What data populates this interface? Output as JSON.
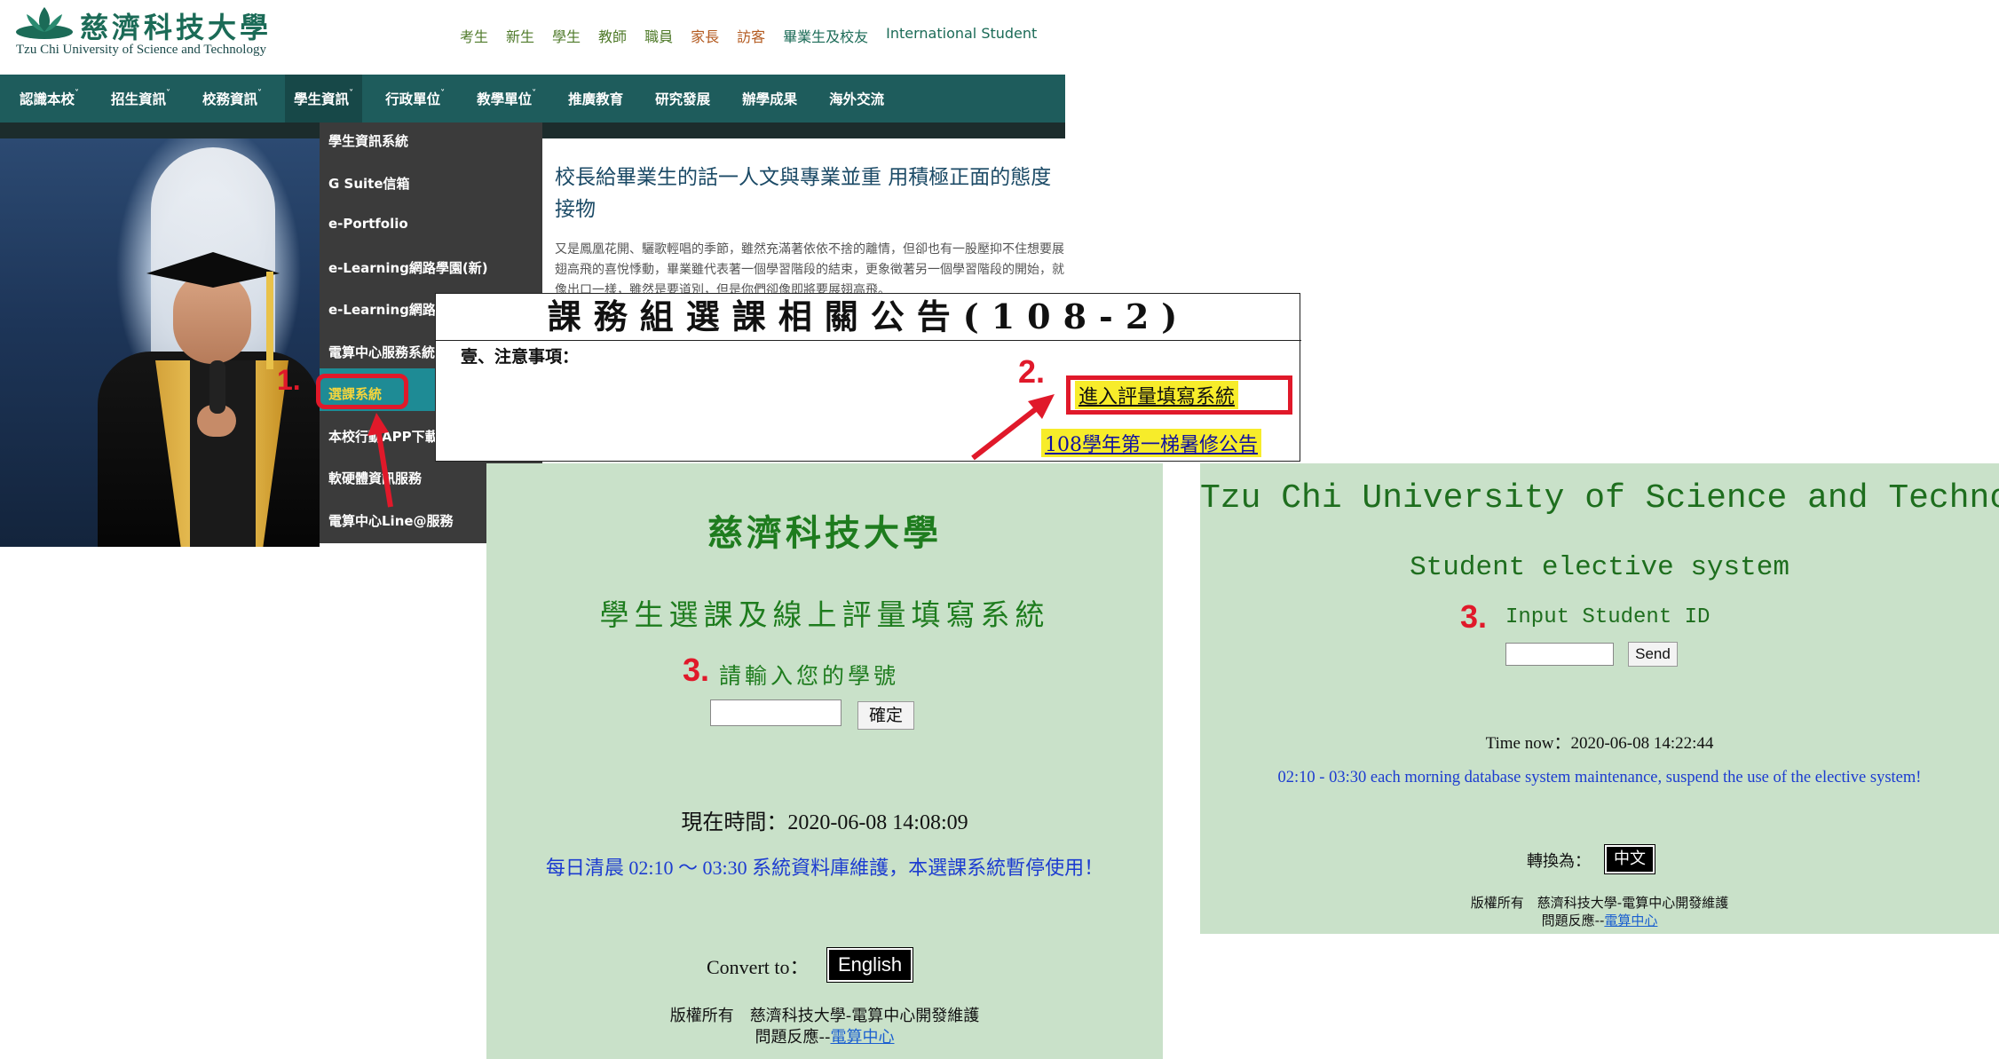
{
  "homepage": {
    "logo_cn": "慈濟科技大學",
    "logo_en": "Tzu Chi University of Science and Technology",
    "top_links": [
      {
        "label": "考生",
        "color": "green"
      },
      {
        "label": "新生",
        "color": "green"
      },
      {
        "label": "學生",
        "color": "green"
      },
      {
        "label": "教師",
        "color": "green"
      },
      {
        "label": "職員",
        "color": "green"
      },
      {
        "label": "家長",
        "color": "orange"
      },
      {
        "label": "訪客",
        "color": "orange"
      },
      {
        "label": "畢業生及校友",
        "color": "teal"
      },
      {
        "label": "International Student",
        "color": "teal"
      }
    ],
    "nav": [
      {
        "label": "認識本校",
        "caret": true
      },
      {
        "label": "招生資訊",
        "caret": true
      },
      {
        "label": "校務資訊",
        "caret": true
      },
      {
        "label": "學生資訊",
        "caret": true,
        "active": true
      },
      {
        "label": "行政單位",
        "caret": true
      },
      {
        "label": "教學單位",
        "caret": true
      },
      {
        "label": "推廣教育",
        "caret": false
      },
      {
        "label": "研究發展",
        "caret": false
      },
      {
        "label": "辦學成果",
        "caret": false
      },
      {
        "label": "海外交流",
        "caret": false
      }
    ],
    "dropdown": [
      "學生資訊系統",
      "G Suite信箱",
      "e-Portfolio",
      "e-Learning網路學園(新)",
      "e-Learning網路學",
      "電算中心服務系統",
      "選課系統",
      "本校行動APP下載",
      "軟硬體資訊服務",
      "電算中心Line@服務"
    ],
    "dropdown_selected_index": 6,
    "article_title": "校長給畢業生的話一人文與專業並重 用積極正面的態度接物",
    "article_body": "又是鳳凰花開、驪歌輕唱的季節，雖然充滿著依依不捨的離情，但卻也有一股壓抑不住想要展翅高飛的喜悅悸動，畢業雖代表著一個學習階段的結束，更象徵著另一個學習階段的開始，就像出口一樣，雖然是要道別，但是你們卻像即將要展翅高飛。"
  },
  "announcement": {
    "title": "課務組選課相關公告(108-2)",
    "section": "壹、注意事項：",
    "eval_link": "進入評量填寫系統",
    "summer_link": "108學年第一梯暑修公告"
  },
  "steps": {
    "step1": "1.",
    "step2": "2.",
    "step3": "3."
  },
  "login_cn": {
    "school": "慈濟科技大學",
    "system": "學生選課及線上評量填寫系統",
    "prompt": "請輸入您的學號",
    "submit": "確定",
    "time": "現在時間：2020-06-08 14:08:09",
    "maintenance": "每日清晨 02:10 ～ 03:30 系統資料庫維護，本選課系統暫停使用！",
    "convert_label": "Convert to：",
    "convert_button": "English",
    "copyright": "版權所有　慈濟科技大學-電算中心開發維護",
    "feedback_prefix": "問題反應--",
    "feedback_link": "電算中心"
  },
  "login_en": {
    "school": "Tzu Chi University of Science and Technology",
    "system": "Student elective system",
    "prompt": "Input Student ID",
    "submit": "Send",
    "time": "Time now：2020-06-08 14:22:44",
    "maintenance": "02:10 - 03:30 each morning database system maintenance, suspend the use of the elective system!",
    "convert_label": "轉換為：",
    "convert_button": "中文",
    "copyright": "版權所有　慈濟科技大學-電算中心開發維護",
    "feedback_prefix": "問題反應--",
    "feedback_link": "電算中心"
  },
  "colors": {
    "nav_bg": "#1e5c5c",
    "panel_bg": "#c9e1c9",
    "panel_green": "#1e7c1e",
    "highlight_red": "#e0192a",
    "highlight_yellow": "#f7ec2a"
  }
}
